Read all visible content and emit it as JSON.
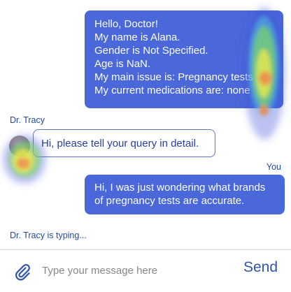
{
  "chat": {
    "intro_message": {
      "lines": [
        "Hello, Doctor!",
        "My name is Alana.",
        "Gender is Not Specified.",
        "Age is NaN.",
        "My main issue is: Pregnancy tests",
        "My current medications are: none"
      ]
    },
    "doctor": {
      "name": "Dr. Tracy",
      "message": "Hi, please tell your query in detail.",
      "typing_status": "Dr. Tracy is typing..."
    },
    "user": {
      "label": "You",
      "message_lines": [
        "Hi, I was just wondering what brands",
        "of pregnancy tests are accurate."
      ]
    }
  },
  "composer": {
    "placeholder": "Type your message here",
    "send_label": "Send",
    "attach_icon": "paperclip-icon"
  },
  "colors": {
    "user_bubble": "#4a68d9",
    "doctor_text": "#243f9a",
    "accent": "#2f55a8"
  }
}
